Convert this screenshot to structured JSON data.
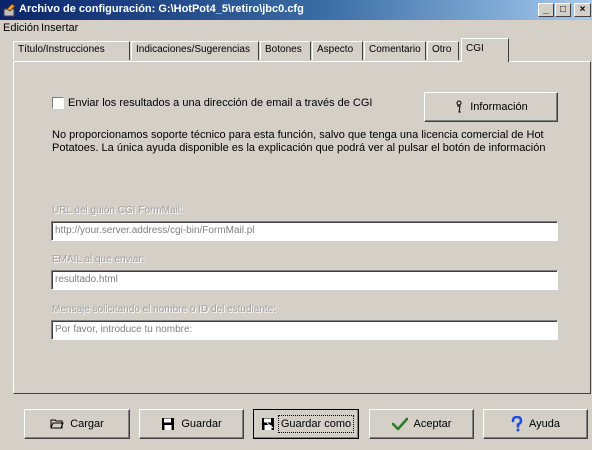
{
  "window": {
    "title": "Archivo de configuración: G:\\HotPot4_5\\retiro\\jbc0.cfg",
    "minimize_glyph": "_",
    "maximize_glyph": "□",
    "close_glyph": "×"
  },
  "menu": {
    "items": [
      "Edición",
      "Insertar"
    ]
  },
  "tabs": [
    "Título/Instrucciones",
    "Indicaciones/Sugerencias",
    "Botones",
    "Aspecto",
    "Comentario",
    "Otro",
    "CGI"
  ],
  "active_tab": "CGI",
  "cgi": {
    "checkbox_label": "Enviar los resultados a una dirección de email a través de CGI",
    "checkbox_checked": false,
    "info_button": "Información",
    "description": "No proporcionamos soporte técnico para esta función, salvo que tenga una licencia comercial de Hot Potatoes.  La única ayuda disponible es la explicación que podrá ver al pulsar el botón de información",
    "url_label": "URL del guión CGI FormMail:",
    "url_value": "http://your.server.address/cgi-bin/FormMail.pl",
    "email_label": "EMAIL al que enviar:",
    "email_value": "resultado.html",
    "name_label": "Mensaje solicitando el nombre o ID del estudiante:",
    "name_value": "Por favor, introduce tu nombre:"
  },
  "buttons": {
    "load": "Cargar",
    "save": "Guardar",
    "save_as": "Guardar como",
    "accept": "Aceptar",
    "help": "Ayuda"
  },
  "colors": {
    "titlebar_start": "#0a246a",
    "titlebar_end": "#a6caf0",
    "face": "#d4d0c8",
    "accept_check": "#2c7a2c",
    "help_mark": "#1e4fd8"
  },
  "icons": {
    "app": "hot-potatoes-icon",
    "info": "info-icon",
    "load": "open-folder-icon",
    "save": "floppy-disk-icon",
    "save_as": "floppy-disk-as-icon",
    "accept": "checkmark-icon",
    "help": "question-mark-icon"
  }
}
